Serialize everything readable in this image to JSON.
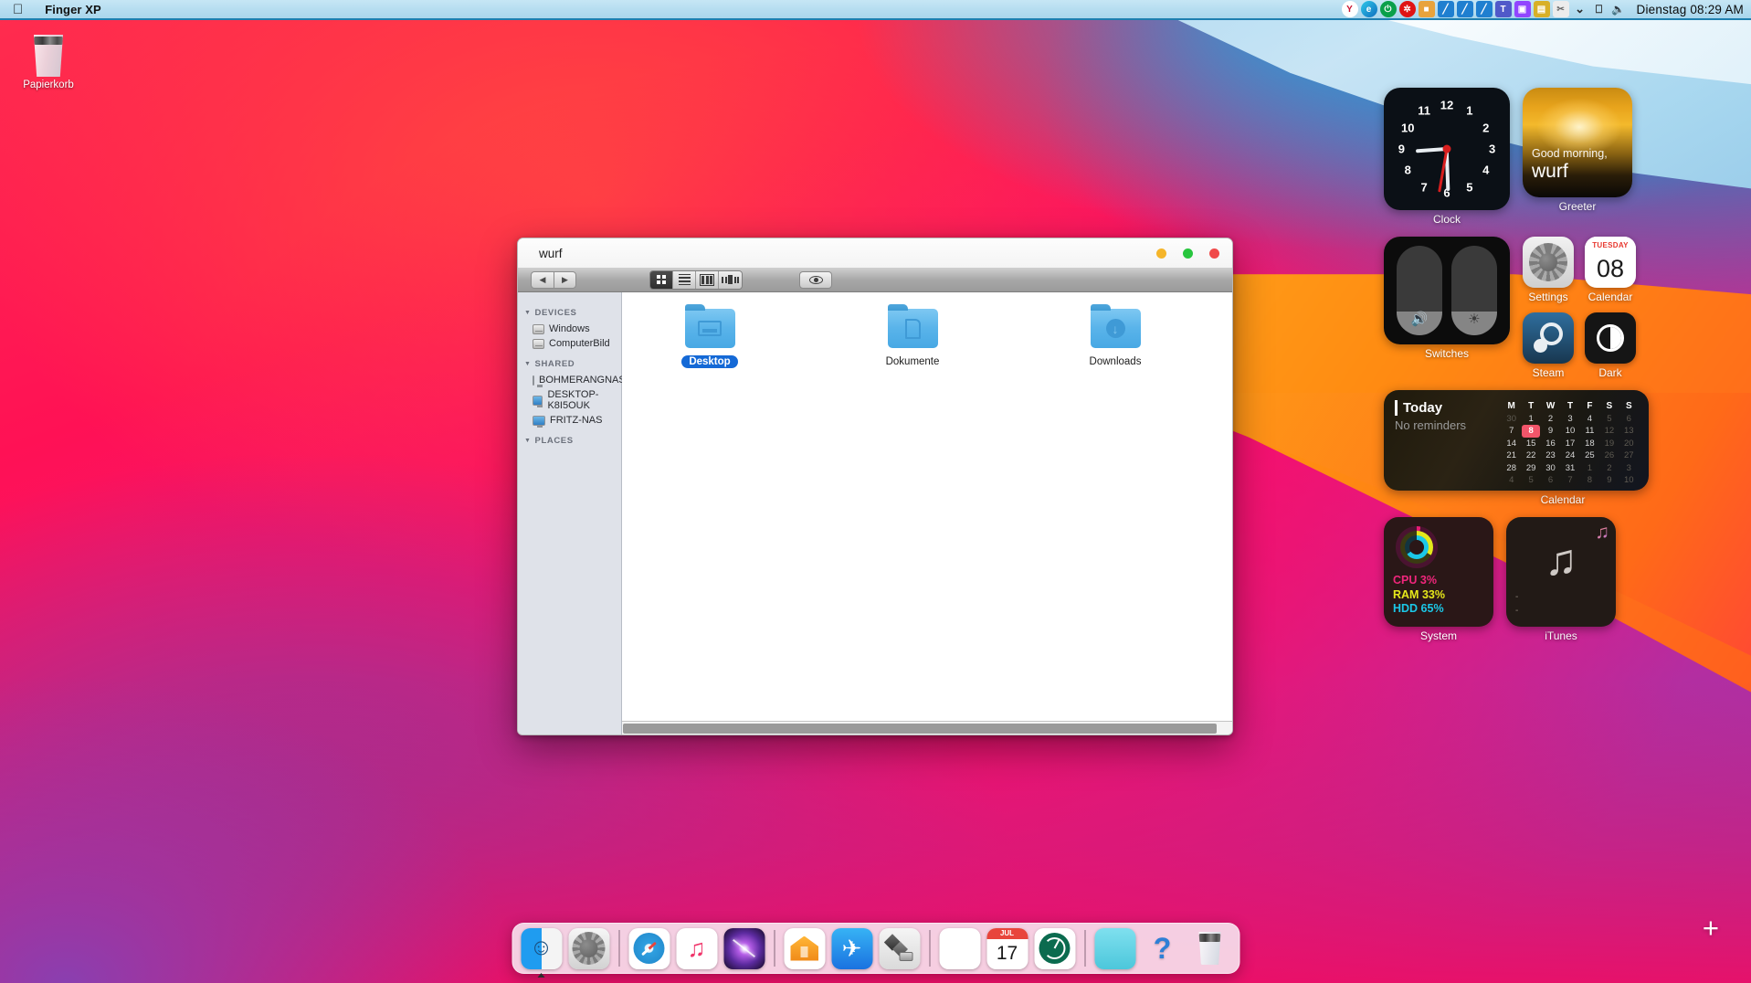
{
  "menubar": {
    "apple_glyph": "",
    "app_name": "Finger XP",
    "clock": "Dienstag 08:29 AM",
    "tray_icons": [
      {
        "name": "yandex-icon",
        "glyph": "Y",
        "bg": "#ffffff",
        "fg": "#c8102e"
      },
      {
        "name": "edge-icon",
        "glyph": "e",
        "bg": "#0f7cc4",
        "fg": "#ffffff"
      },
      {
        "name": "power-icon",
        "glyph": "⏻",
        "bg": "#0aa04a",
        "fg": "#ffffff"
      },
      {
        "name": "red-alert-icon",
        "glyph": "✲",
        "bg": "#e01414",
        "fg": "#ffffff"
      },
      {
        "name": "folder-tray-icon",
        "glyph": "■",
        "bg": "#e8a33c",
        "fg": "#ffffff"
      },
      {
        "name": "vscode-icon-1",
        "glyph": "╱",
        "bg": "#1f7fd0",
        "fg": "#ffffff"
      },
      {
        "name": "vscode-icon-2",
        "glyph": "╱",
        "bg": "#1f7fd0",
        "fg": "#ffffff"
      },
      {
        "name": "vscode-icon-3",
        "glyph": "╱",
        "bg": "#1f7fd0",
        "fg": "#ffffff"
      },
      {
        "name": "teams-icon",
        "glyph": "T",
        "bg": "#5059c9",
        "fg": "#ffffff"
      },
      {
        "name": "twitch-icon",
        "glyph": "▣",
        "bg": "#9146ff",
        "fg": "#ffffff"
      },
      {
        "name": "app-tray-icon",
        "glyph": "▤",
        "bg": "#d8b028",
        "fg": "#ffffff"
      },
      {
        "name": "snipping-tool-icon",
        "glyph": "✂",
        "bg": "#e6e6e6",
        "fg": "#555555"
      },
      {
        "name": "chevron-down-icon",
        "glyph": "⌄",
        "bg": "transparent",
        "fg": "#2a2a2a"
      },
      {
        "name": "network-icon",
        "glyph": "⬚",
        "bg": "transparent",
        "fg": "#2a2a2a"
      },
      {
        "name": "volume-icon",
        "glyph": "🔊",
        "bg": "transparent",
        "fg": "#2a2a2a"
      }
    ]
  },
  "desktop": {
    "trash_label": "Papierkorb",
    "add_widget_glyph": "+"
  },
  "finder": {
    "title": "wurf",
    "window_lights": [
      {
        "name": "minimize-button",
        "color": "#f5b52a"
      },
      {
        "name": "zoom-button",
        "color": "#28c63e"
      },
      {
        "name": "close-button",
        "color": "#f04a4a"
      }
    ],
    "nav": {
      "back_glyph": "◀",
      "forward_glyph": "▶"
    },
    "views": [
      {
        "name": "icon-view-button",
        "label": "Icon view",
        "active": true
      },
      {
        "name": "list-view-button",
        "label": "List view",
        "active": false
      },
      {
        "name": "column-view-button",
        "label": "Column view",
        "active": false
      },
      {
        "name": "coverflow-view-button",
        "label": "Cover flow view",
        "active": false
      }
    ],
    "quicklook_label": "Quick Look",
    "sidebar": [
      {
        "header": "DEVICES",
        "items": [
          {
            "label": "Windows",
            "icon": "hard-disk-icon"
          },
          {
            "label": "ComputerBild",
            "icon": "hard-disk-icon"
          }
        ]
      },
      {
        "header": "SHARED",
        "items": [
          {
            "label": "BOHMERANGNAS",
            "icon": "monitor-icon"
          },
          {
            "label": "DESKTOP-K8I5OUK",
            "icon": "monitor-icon"
          },
          {
            "label": "FRITZ-NAS",
            "icon": "monitor-icon"
          }
        ]
      },
      {
        "header": "PLACES",
        "items": []
      }
    ],
    "files": [
      {
        "label": "Desktop",
        "glyph": "desktop-folder-icon",
        "selected": true
      },
      {
        "label": "Dokumente",
        "glyph": "documents-folder-icon",
        "selected": false
      },
      {
        "label": "Downloads",
        "glyph": "downloads-folder-icon",
        "selected": false
      }
    ]
  },
  "widgets": {
    "clock": {
      "label": "Clock",
      "numbers": [
        "12",
        "1",
        "2",
        "3",
        "4",
        "5",
        "6",
        "7",
        "8",
        "9",
        "10",
        "11"
      ]
    },
    "greeter": {
      "label": "Greeter",
      "greeting": "Good morning,",
      "user": "wurf"
    },
    "switches": {
      "label": "Switches",
      "volume_glyph": "🔊",
      "brightness_glyph": "☀"
    },
    "settings": {
      "label": "Settings"
    },
    "calendar_tile": {
      "label": "Calendar",
      "weekday": "TUESDAY",
      "day": "08"
    },
    "steam": {
      "label": "Steam"
    },
    "dark": {
      "label": "Dark"
    },
    "today": {
      "label": "Calendar",
      "heading": "Today",
      "subtext": "No reminders",
      "dow": [
        "M",
        "T",
        "W",
        "T",
        "F",
        "S",
        "S"
      ],
      "days": [
        {
          "n": "30",
          "state": "dim"
        },
        {
          "n": "1",
          "state": ""
        },
        {
          "n": "2",
          "state": ""
        },
        {
          "n": "3",
          "state": ""
        },
        {
          "n": "4",
          "state": ""
        },
        {
          "n": "5",
          "state": "dim"
        },
        {
          "n": "6",
          "state": "dim"
        },
        {
          "n": "7",
          "state": ""
        },
        {
          "n": "8",
          "state": "sel"
        },
        {
          "n": "9",
          "state": ""
        },
        {
          "n": "10",
          "state": ""
        },
        {
          "n": "11",
          "state": ""
        },
        {
          "n": "12",
          "state": "dim"
        },
        {
          "n": "13",
          "state": "dim"
        },
        {
          "n": "14",
          "state": ""
        },
        {
          "n": "15",
          "state": ""
        },
        {
          "n": "16",
          "state": ""
        },
        {
          "n": "17",
          "state": ""
        },
        {
          "n": "18",
          "state": ""
        },
        {
          "n": "19",
          "state": "dim"
        },
        {
          "n": "20",
          "state": "dim"
        },
        {
          "n": "21",
          "state": ""
        },
        {
          "n": "22",
          "state": ""
        },
        {
          "n": "23",
          "state": ""
        },
        {
          "n": "24",
          "state": ""
        },
        {
          "n": "25",
          "state": ""
        },
        {
          "n": "26",
          "state": "dim"
        },
        {
          "n": "27",
          "state": "dim"
        },
        {
          "n": "28",
          "state": ""
        },
        {
          "n": "29",
          "state": ""
        },
        {
          "n": "30",
          "state": ""
        },
        {
          "n": "31",
          "state": ""
        },
        {
          "n": "1",
          "state": "dim"
        },
        {
          "n": "2",
          "state": "dim"
        },
        {
          "n": "3",
          "state": "dim"
        },
        {
          "n": "4",
          "state": "dim"
        },
        {
          "n": "5",
          "state": "dim"
        },
        {
          "n": "6",
          "state": "dim"
        },
        {
          "n": "7",
          "state": "dim"
        },
        {
          "n": "8",
          "state": "dim"
        },
        {
          "n": "9",
          "state": "dim"
        },
        {
          "n": "10",
          "state": "dim"
        }
      ]
    },
    "system": {
      "label": "System",
      "cpu": "CPU 3%",
      "ram": "RAM 33%",
      "hdd": "HDD 65%"
    },
    "itunes": {
      "label": "iTunes",
      "note_glyph": "♫",
      "badge_glyph": "♫",
      "line1": "-",
      "line2": "-"
    }
  },
  "dock": {
    "items": [
      {
        "name": "dock-finder",
        "label": "Finder",
        "running": true
      },
      {
        "name": "dock-system-preferences",
        "label": "System Preferences",
        "running": false
      },
      {
        "name": "dock-separator-1",
        "label": "",
        "separator": true
      },
      {
        "name": "dock-safari",
        "label": "Safari",
        "running": false
      },
      {
        "name": "dock-music",
        "label": "Music",
        "running": false
      },
      {
        "name": "dock-siri",
        "label": "Siri",
        "running": false
      },
      {
        "name": "dock-separator-2",
        "label": "",
        "separator": true
      },
      {
        "name": "dock-home",
        "label": "Home",
        "running": false
      },
      {
        "name": "dock-app-store",
        "label": "App Store",
        "running": false
      },
      {
        "name": "dock-disk-utility",
        "label": "Disk Utility",
        "running": false
      },
      {
        "name": "dock-separator-3",
        "label": "",
        "separator": true
      },
      {
        "name": "dock-launchpad",
        "label": "Launchpad",
        "running": false
      },
      {
        "name": "dock-calendar",
        "label": "Calendar",
        "running": true
      },
      {
        "name": "dock-time-machine",
        "label": "Time Machine",
        "running": false
      },
      {
        "name": "dock-separator-4",
        "label": "",
        "separator": true
      },
      {
        "name": "dock-stickies",
        "label": "Stickies",
        "running": false
      },
      {
        "name": "dock-help",
        "label": "Help",
        "running": false
      },
      {
        "name": "dock-trash",
        "label": "Trash",
        "running": false
      }
    ],
    "calendar_month": "JUL",
    "calendar_day": "17",
    "help_glyph": "?",
    "music_glyph": "♫",
    "appstore_glyph": "✈",
    "finder_face": "☺"
  }
}
